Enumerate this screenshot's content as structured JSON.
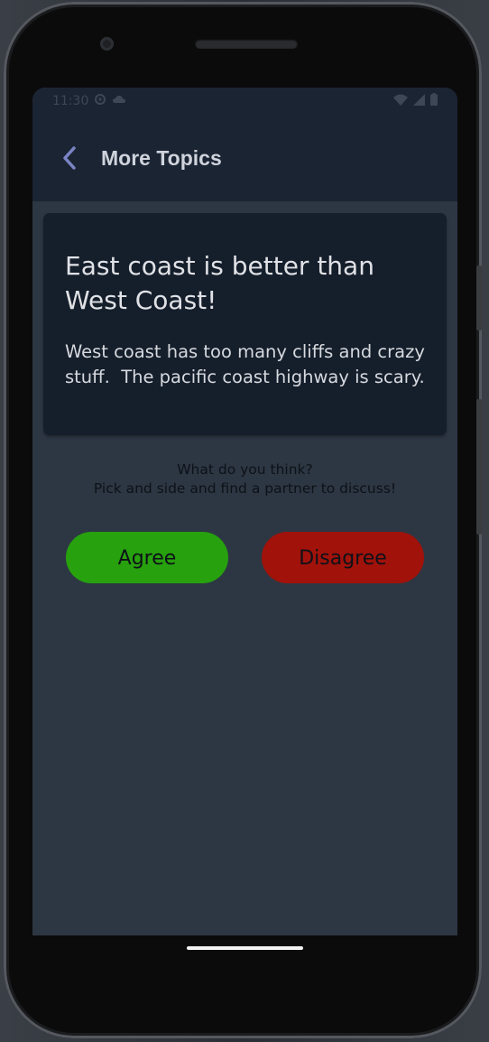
{
  "status_bar": {
    "time": "11:30",
    "icons_left": [
      "gear-icon",
      "cloud-icon"
    ],
    "icons_right": [
      "wifi-icon",
      "signal-icon",
      "battery-icon"
    ]
  },
  "app_bar": {
    "title": "More Topics",
    "back_icon": "chevron-left-icon"
  },
  "topic": {
    "title": "East coast is better than West Coast!",
    "body": "West coast has too many cliffs and crazy stuff.  The pacific coast highway is scary."
  },
  "prompt": {
    "line1": "What do you think?",
    "line2": "Pick and side and find a partner to discuss!"
  },
  "actions": {
    "agree_label": "Agree",
    "disagree_label": "Disagree"
  },
  "colors": {
    "app_bar_bg": "#1b2433",
    "screen_bg": "#2d3743",
    "card_bg": "#151e2b",
    "agree": "#27a10e",
    "disagree": "#a1120a",
    "back_icon": "#7b84c4"
  }
}
